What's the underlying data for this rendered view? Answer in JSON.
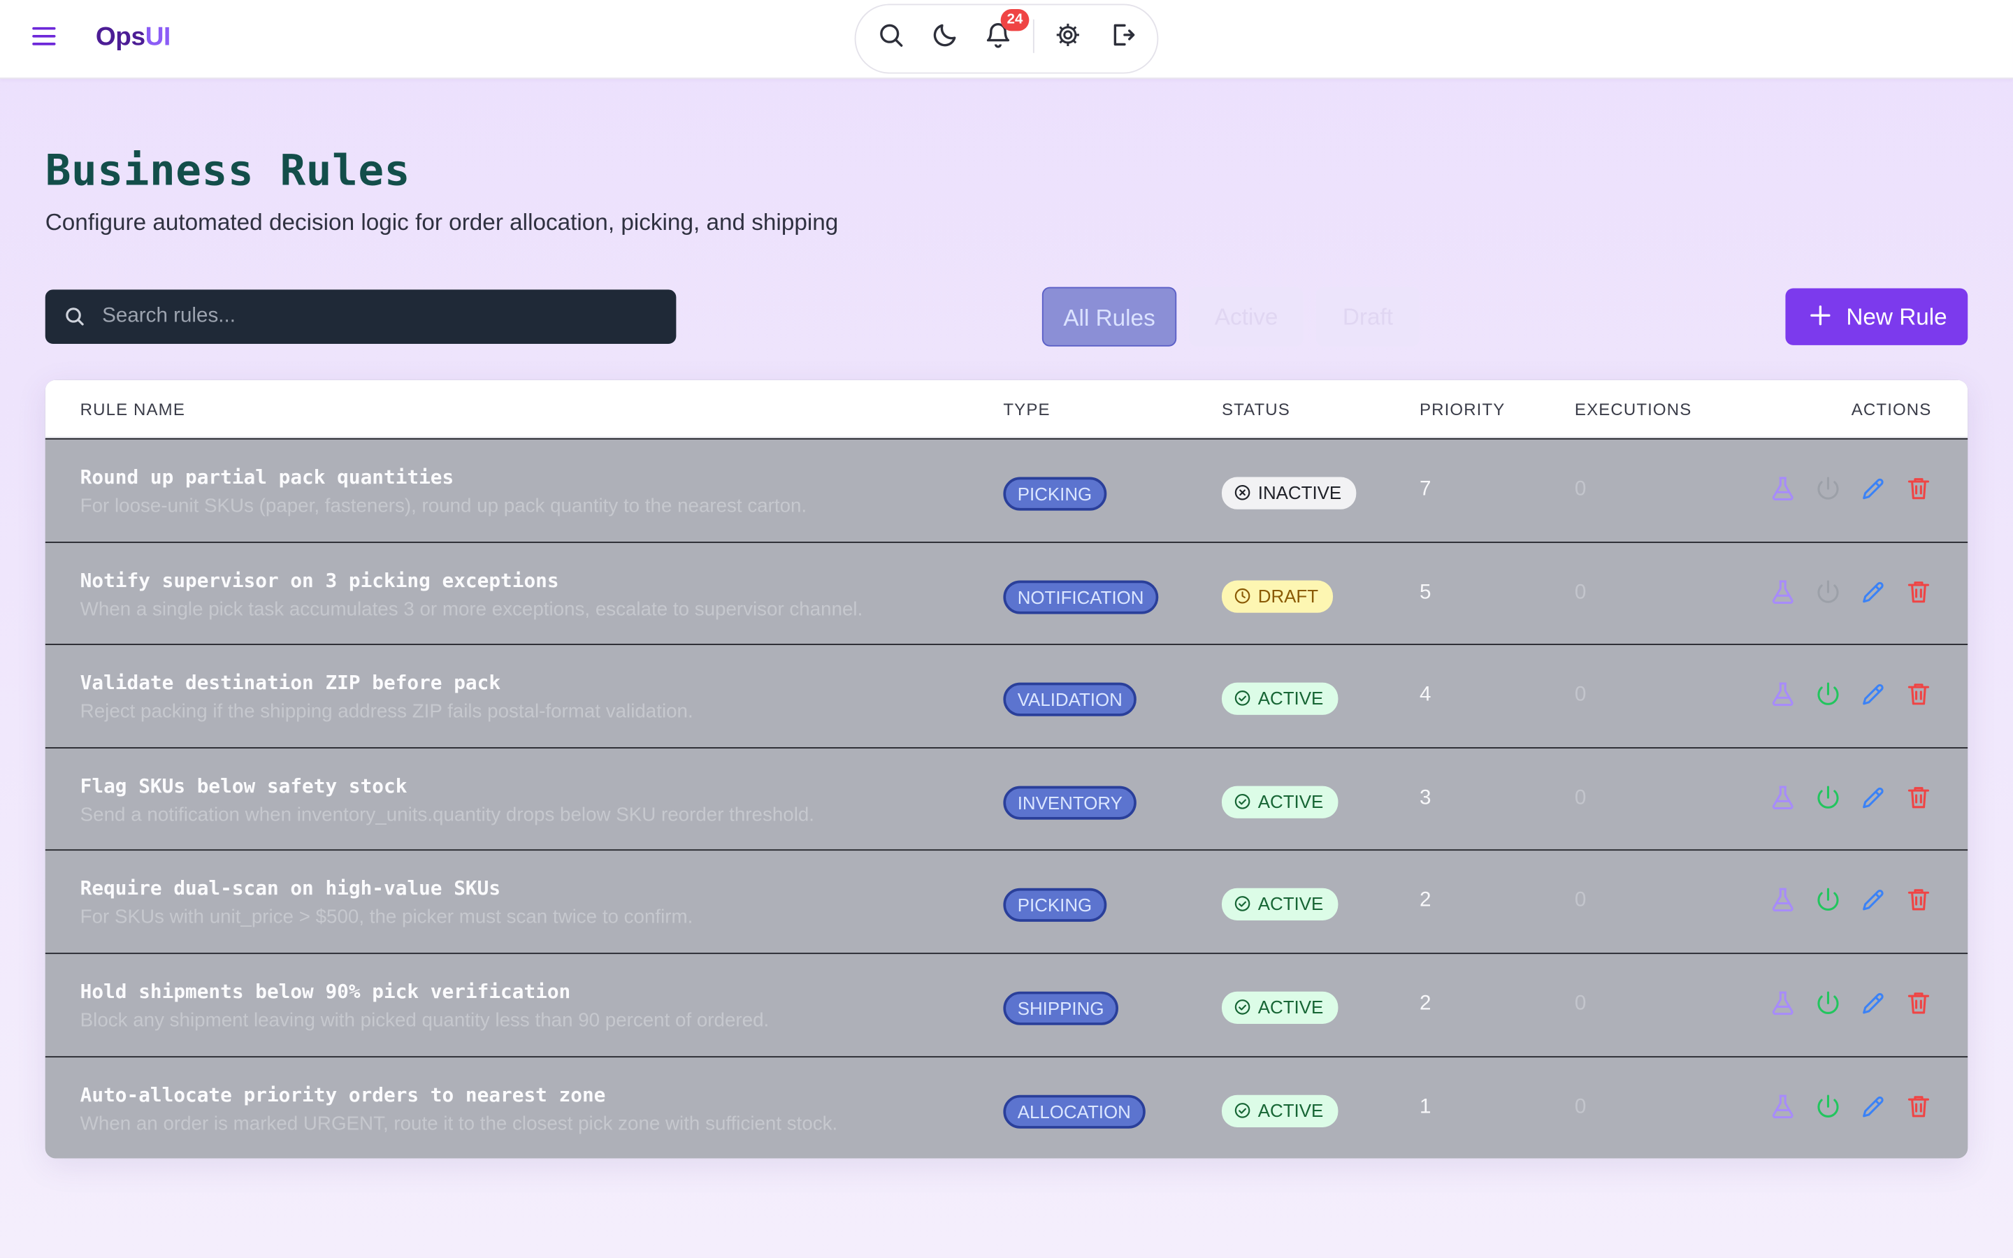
{
  "app": {
    "brand_main": "Ops",
    "brand_accent": "UI",
    "notification_count": "24"
  },
  "header": {
    "title": "Business Rules",
    "subtitle": "Configure automated decision logic for order allocation, picking, and shipping"
  },
  "search": {
    "placeholder": "Search rules..."
  },
  "filters": {
    "all": "All Rules",
    "active": "Active",
    "draft": "Draft"
  },
  "new_rule_label": "New Rule",
  "columns": {
    "name": "RULE NAME",
    "type": "TYPE",
    "status": "STATUS",
    "priority": "PRIORITY",
    "executions": "EXECUTIONS",
    "actions": "ACTIONS"
  },
  "rules": [
    {
      "name": "Round up partial pack quantities",
      "description": "For loose-unit SKUs (paper, fasteners), round up pack quantity to the nearest carton.",
      "type": "PICKING",
      "status": "INACTIVE",
      "priority": "7",
      "executions": "0"
    },
    {
      "name": "Notify supervisor on 3 picking exceptions",
      "description": "When a single pick task accumulates 3 or more exceptions, escalate to supervisor channel.",
      "type": "NOTIFICATION",
      "status": "DRAFT",
      "priority": "5",
      "executions": "0"
    },
    {
      "name": "Validate destination ZIP before pack",
      "description": "Reject packing if the shipping address ZIP fails postal-format validation.",
      "type": "VALIDATION",
      "status": "ACTIVE",
      "priority": "4",
      "executions": "0"
    },
    {
      "name": "Flag SKUs below safety stock",
      "description": "Send a notification when inventory_units.quantity drops below SKU reorder threshold.",
      "type": "INVENTORY",
      "status": "ACTIVE",
      "priority": "3",
      "executions": "0"
    },
    {
      "name": "Require dual-scan on high-value SKUs",
      "description": "For SKUs with unit_price > $500, the picker must scan twice to confirm.",
      "type": "PICKING",
      "status": "ACTIVE",
      "priority": "2",
      "executions": "0"
    },
    {
      "name": "Hold shipments below 90% pick verification",
      "description": "Block any shipment leaving with picked quantity less than 90 percent of ordered.",
      "type": "SHIPPING",
      "status": "ACTIVE",
      "priority": "2",
      "executions": "0"
    },
    {
      "name": "Auto-allocate priority orders to nearest zone",
      "description": "When an order is marked URGENT, route it to the closest pick zone with sufficient stock.",
      "type": "ALLOCATION",
      "status": "ACTIVE",
      "priority": "1",
      "executions": "0"
    }
  ],
  "colors": {
    "brand": "#4c1d95",
    "accent": "#7c3aed",
    "active": "#22c55e",
    "draft": "#eab308",
    "danger": "#ef4444",
    "edit": "#3b82f6"
  },
  "icons": [
    "menu-icon",
    "search-icon",
    "moon-icon",
    "bell-icon",
    "gear-icon",
    "logout-icon",
    "plus-icon",
    "flask-icon",
    "power-icon",
    "pencil-icon",
    "trash-icon",
    "x-circle-icon",
    "clock-icon",
    "check-circle-icon"
  ]
}
